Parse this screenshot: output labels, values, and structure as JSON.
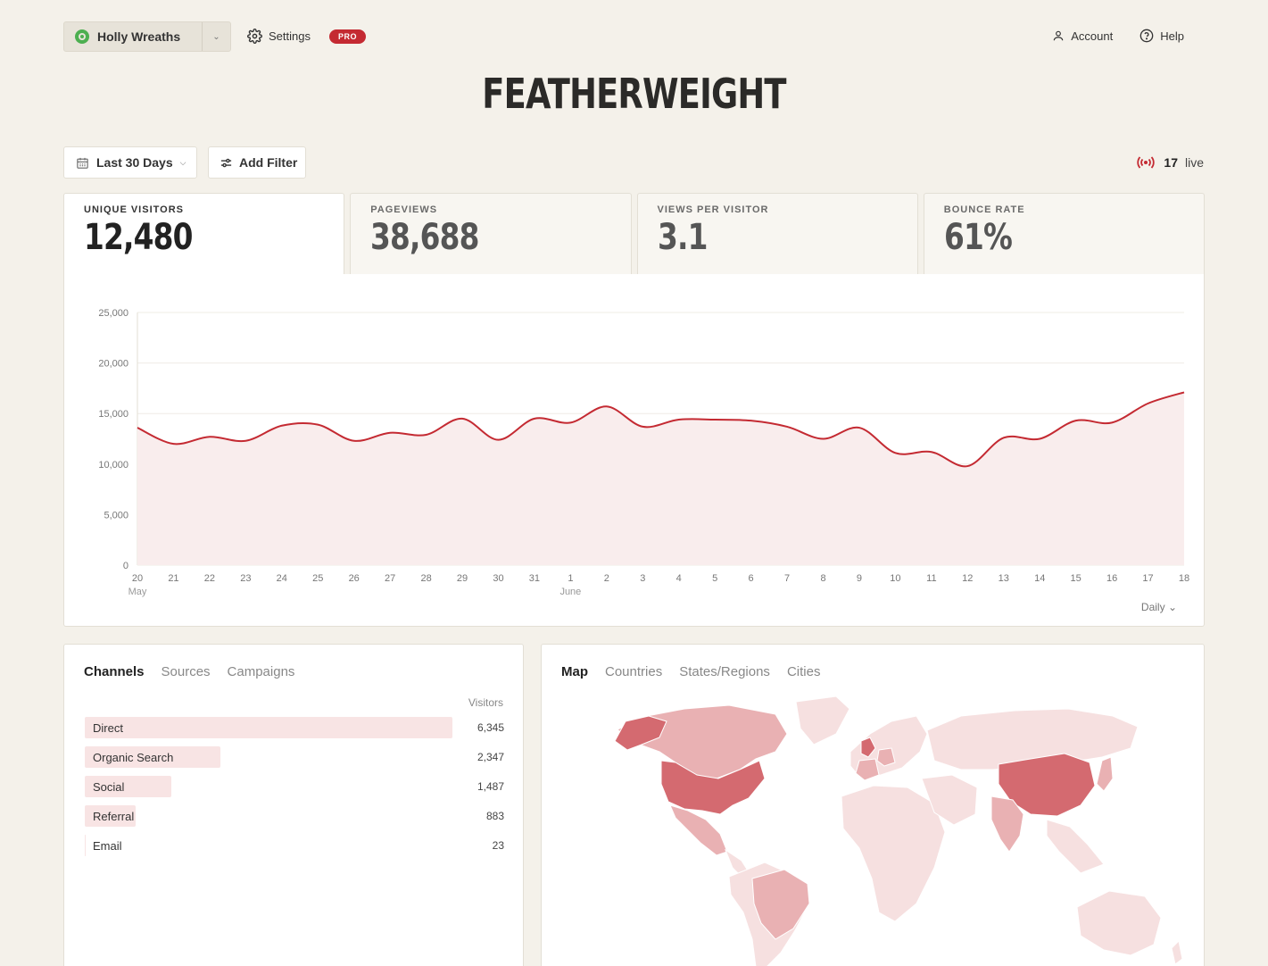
{
  "site": {
    "name": "Holly Wreaths"
  },
  "header": {
    "settings_label": "Settings",
    "pro_badge": "PRO",
    "account_label": "Account",
    "help_label": "Help",
    "logo_text": "FEATHERWEIGHT"
  },
  "filters": {
    "date_range": "Last 30 Days",
    "add_filter": "Add Filter"
  },
  "live": {
    "count": "17",
    "label": "live"
  },
  "stats": [
    {
      "label": "UNIQUE VISITORS",
      "value": "12,480"
    },
    {
      "label": "PAGEVIEWS",
      "value": "38,688"
    },
    {
      "label": "VIEWS PER VISITOR",
      "value": "3.1"
    },
    {
      "label": "BOUNCE RATE",
      "value": "61%"
    }
  ],
  "chart": {
    "interval_label": "Daily"
  },
  "chart_data": {
    "type": "area",
    "title": "",
    "xlabel": "",
    "ylabel": "",
    "x": [
      "20",
      "21",
      "22",
      "23",
      "24",
      "25",
      "26",
      "27",
      "28",
      "29",
      "30",
      "31",
      "1",
      "2",
      "3",
      "4",
      "5",
      "6",
      "7",
      "8",
      "9",
      "10",
      "11",
      "12",
      "13",
      "14",
      "15",
      "16",
      "17",
      "18"
    ],
    "month_labels": [
      {
        "at": "20",
        "text": "May"
      },
      {
        "at": "1",
        "text": "June"
      }
    ],
    "series": [
      {
        "values": [
          13600,
          12000,
          12700,
          12300,
          13800,
          13900,
          12300,
          13100,
          12900,
          14500,
          12400,
          14500,
          14100,
          15700,
          13700,
          14400,
          14400,
          14300,
          13700,
          12500,
          13600,
          11100,
          11200,
          9800,
          12600,
          12500,
          14300,
          14100,
          16000,
          17100
        ]
      }
    ],
    "ylim": [
      0,
      25000
    ],
    "yticks": [
      0,
      5000,
      10000,
      15000,
      20000,
      25000
    ],
    "ytick_labels": [
      "0",
      "5,000",
      "10,000",
      "15,000",
      "20,000",
      "25,000"
    ],
    "grid": true,
    "line_color": "#c42a32",
    "fill_color": "#f9eded"
  },
  "channels_panel": {
    "tabs": [
      "Channels",
      "Sources",
      "Campaigns"
    ],
    "column_header": "Visitors",
    "rows": [
      {
        "name": "Direct",
        "visitors": "6,345",
        "value": 6345
      },
      {
        "name": "Organic Search",
        "visitors": "2,347",
        "value": 2347
      },
      {
        "name": "Social",
        "visitors": "1,487",
        "value": 1487
      },
      {
        "name": "Referral",
        "visitors": "883",
        "value": 883
      },
      {
        "name": "Email",
        "visitors": "23",
        "value": 23
      }
    ]
  },
  "map_panel": {
    "tabs": [
      "Map",
      "Countries",
      "States/Regions",
      "Cities"
    ]
  },
  "colors": {
    "accent": "#c42a32",
    "background": "#f4f1ea",
    "bar_fill": "#f8e4e4",
    "map_high": "#d46a70",
    "map_mid": "#e9b1b3",
    "map_low": "#f6e0e0"
  }
}
